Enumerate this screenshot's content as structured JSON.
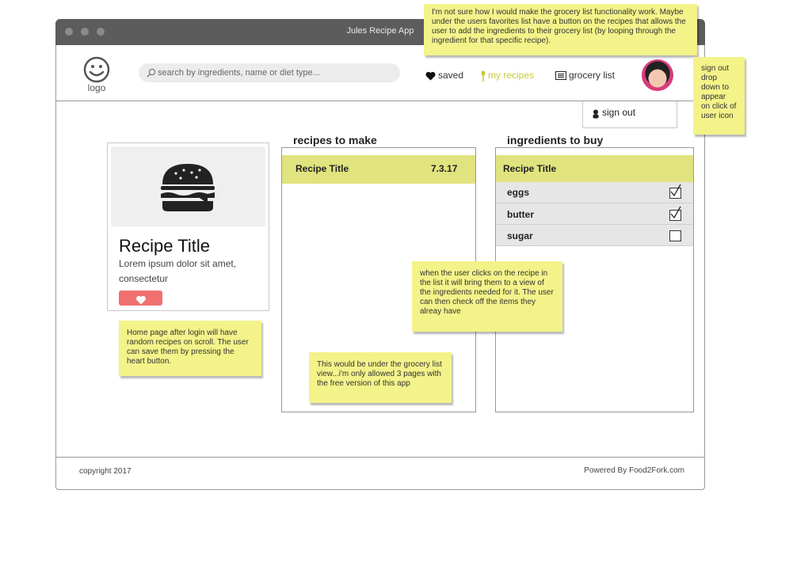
{
  "window": {
    "title": "Jules Recipe App"
  },
  "header": {
    "logo_label": "logo",
    "search_placeholder": "search by ingredients, name or diet type...",
    "nav": {
      "saved": "saved",
      "my_recipes": "my recipes",
      "grocery_list": "grocery list"
    },
    "signout_label": "sign out"
  },
  "card": {
    "title": "Recipe Title",
    "description": "Lorem ipsum dolor sit amet, consectetur"
  },
  "recipes_panel": {
    "legend": "recipes to make",
    "rows": [
      {
        "title": "Recipe Title",
        "date": "7.3.17"
      }
    ]
  },
  "ingredients_panel": {
    "legend": "ingredients to buy",
    "header": "Recipe Title",
    "items": [
      {
        "name": "eggs",
        "checked": true
      },
      {
        "name": "butter",
        "checked": true
      },
      {
        "name": "sugar",
        "checked": false
      }
    ]
  },
  "footer": {
    "copyright": "copyright 2017",
    "powered": "Powered By Food2Fork.com"
  },
  "notes": {
    "top": "I'm not sure how I would make the grocery list functionality work. Maybe under the users favorites list have a button on the recipes that allows the user to add the ingredients to their grocery list (by looping through the ingredient for that specific recipe).",
    "signout": "sign out drop down to appear on click of user icon",
    "home": "Home page after login will have random recipes on scroll. The user can save them by pressing the heart button.",
    "list": "when the user clicks on the recipe in the list it will bring them to a view of the ingredients needed for it. The user can then check off the items they alreay have",
    "free": "This would be under the grocery list view...i'm only allowed 3 pages with the free version of this app"
  },
  "colors": {
    "titlebar": "#5c5c5c",
    "accent_row": "#e0e37e",
    "sticky_note": "#f3f38a",
    "heart_button": "#f07070",
    "my_recipes_active": "#c8c93a"
  }
}
